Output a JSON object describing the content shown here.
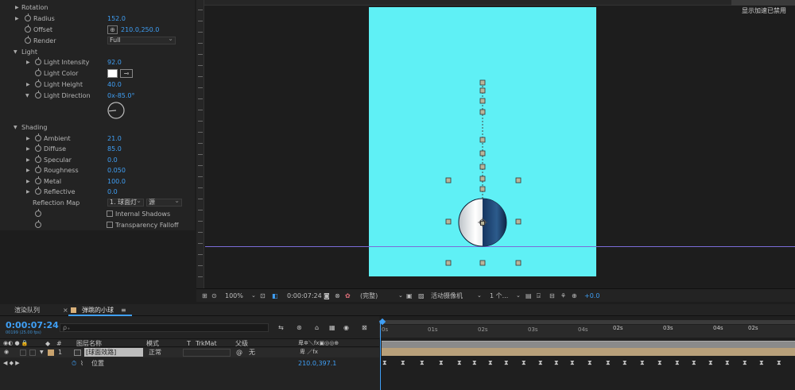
{
  "effects": {
    "rotation_label": "Rotation",
    "radius_label": "Radius",
    "radius_value": "152.0",
    "offset_label": "Offset",
    "offset_value": "210.0,250.0",
    "render_label": "Render",
    "render_value": "Full",
    "light_label": "Light",
    "light_intensity_label": "Light Intensity",
    "light_intensity_value": "92.0",
    "light_color_label": "Light Color",
    "light_color": "#ffffff",
    "light_height_label": "Light Height",
    "light_height_value": "40.0",
    "light_direction_label": "Light Direction",
    "light_direction_value": "0x-85.0°",
    "shading_label": "Shading",
    "ambient_label": "Ambient",
    "ambient_value": "21.0",
    "diffuse_label": "Diffuse",
    "diffuse_value": "85.0",
    "specular_label": "Specular",
    "specular_value": "0.0",
    "roughness_label": "Roughness",
    "roughness_value": "0.050",
    "metal_label": "Metal",
    "metal_value": "100.0",
    "reflective_label": "Reflective",
    "reflective_value": "0.0",
    "reflection_map_label": "Reflection Map",
    "reflection_map_layer": "1. 球面灯",
    "reflection_map_source": "源",
    "internal_shadows_label": "Internal Shadows",
    "transparency_falloff_label": "Transparency Falloff"
  },
  "viewer": {
    "gpu_note": "显示加速已禁用",
    "canvas_color": "#5ff0f5"
  },
  "viewer_toolbar": {
    "zoom": "100%",
    "timecode": "0:00:07:24",
    "resolution": "(完整)",
    "camera": "活动摄像机",
    "views": "1 个...",
    "exposure": "+0.0"
  },
  "timeline": {
    "tab_render_queue": "渲染队列",
    "tab_comp": "弹跳的小球",
    "current_time": "0:00:07:24",
    "frame_info": "00199 (25.00 fps)",
    "search_placeholder": "ρ₊",
    "col_layer_name": "图层名称",
    "col_mode": "模式",
    "col_t": "T",
    "col_trkmat": "TrkMat",
    "col_parent": "父级",
    "layer_number": "1",
    "layer_name": "[球面效路]",
    "layer_mode": "正常",
    "layer_parent": "无",
    "prop_position_label": "位置",
    "prop_position_value": "210.0,397.1",
    "time_ticks": [
      "0s",
      "01s",
      "02s",
      "03s",
      "04s",
      "02s",
      "03s",
      "04s",
      "02s"
    ]
  }
}
